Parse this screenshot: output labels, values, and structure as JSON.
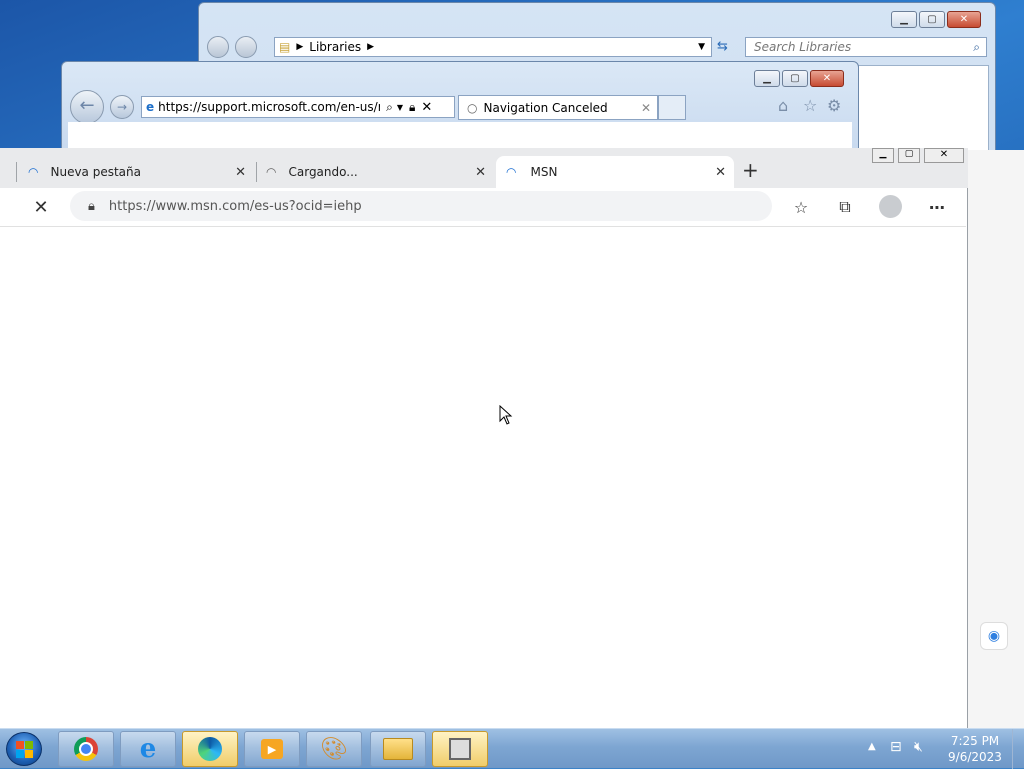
{
  "explorer": {
    "breadcrumb": "Libraries",
    "search_placeholder": "Search Libraries"
  },
  "ie": {
    "address": "https://support.microsoft.com/en-us/mic",
    "tab_title": "Navigation Canceled"
  },
  "edge": {
    "tabs": [
      {
        "label": "Nueva pestaña"
      },
      {
        "label": "Cargando..."
      },
      {
        "label": "MSN"
      }
    ],
    "url": "https://www.msn.com/es-us?ocid=iehp"
  },
  "taskbar": {
    "apps": [
      "start-orb",
      "chrome",
      "internet-explorer",
      "edge",
      "media-player",
      "paint",
      "file-explorer",
      "photo-viewer"
    ],
    "time": "7:25 PM",
    "date": "9/6/2023"
  }
}
